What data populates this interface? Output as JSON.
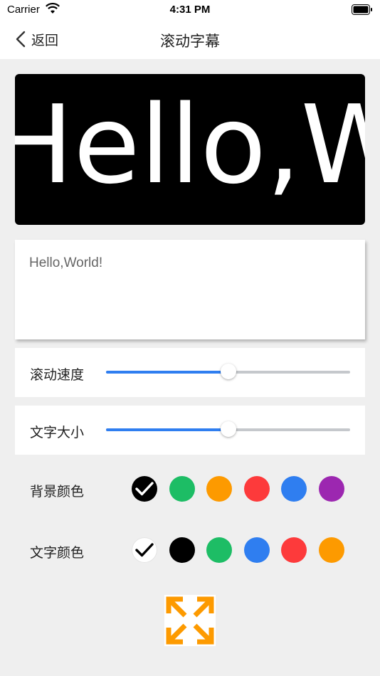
{
  "status_bar": {
    "carrier": "Carrier",
    "time": "4:31 PM"
  },
  "nav": {
    "back_label": "返回",
    "title": "滚动字幕"
  },
  "preview": {
    "text": "Hello,World!",
    "background_color": "#000000",
    "text_color": "#ffffff"
  },
  "text_input": {
    "value": "Hello,World!"
  },
  "sliders": [
    {
      "label": "滚动速度",
      "value": 0.5
    },
    {
      "label": "文字大小",
      "value": 0.5
    }
  ],
  "background_colors": {
    "label": "背景颜色",
    "selected_index": 0,
    "options": [
      "#000000",
      "#1dbd65",
      "#fd9a00",
      "#fd3a3b",
      "#2f7ef0",
      "#9c27b0"
    ]
  },
  "text_colors": {
    "label": "文字颜色",
    "selected_index": 0,
    "options": [
      "#ffffff",
      "#000000",
      "#1dbd65",
      "#2f7ef0",
      "#fd3a3b",
      "#fd9a00"
    ]
  },
  "fullscreen_button": {
    "icon": "fullscreen-expand-icon",
    "color": "#fd9a00"
  },
  "accent_color": "#2f7ef0"
}
